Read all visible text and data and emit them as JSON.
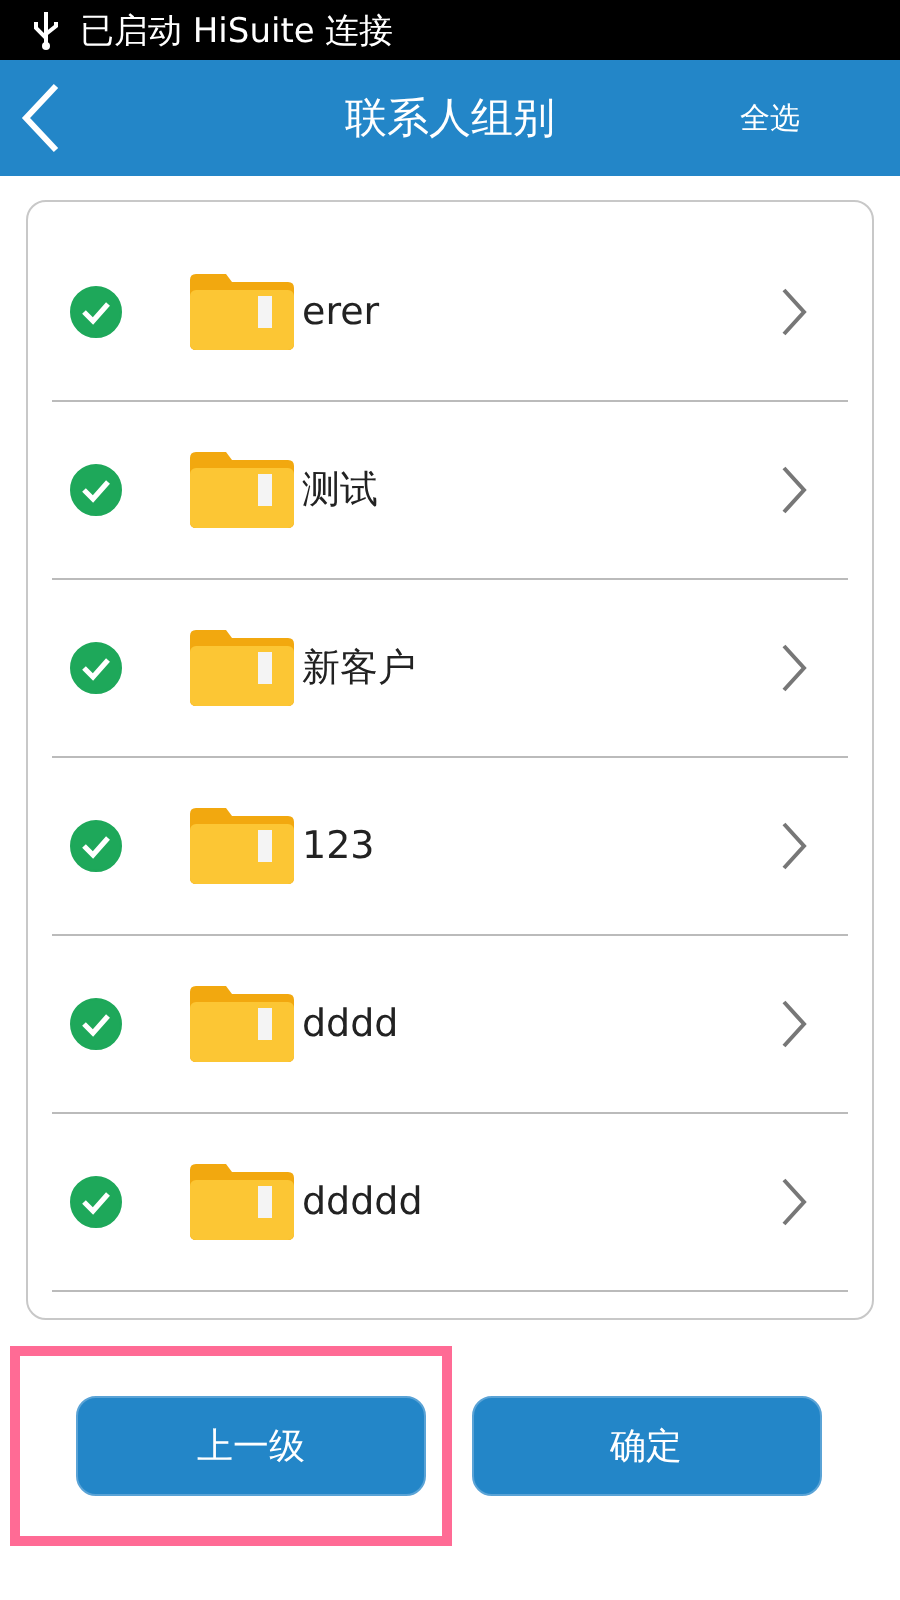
{
  "status_bar": {
    "notification": "已启动 HiSuite 连接"
  },
  "app_bar": {
    "title": "联系人组别",
    "action": "全选"
  },
  "groups": [
    {
      "name": "erer",
      "checked": true
    },
    {
      "name": "测试",
      "checked": true
    },
    {
      "name": "新客户",
      "checked": true
    },
    {
      "name": "123",
      "checked": true
    },
    {
      "name": "dddd",
      "checked": true
    },
    {
      "name": "ddddd",
      "checked": true
    }
  ],
  "buttons": [
    {
      "label": "上一级",
      "highlighted": true
    },
    {
      "label": "确定",
      "highlighted": false
    }
  ]
}
